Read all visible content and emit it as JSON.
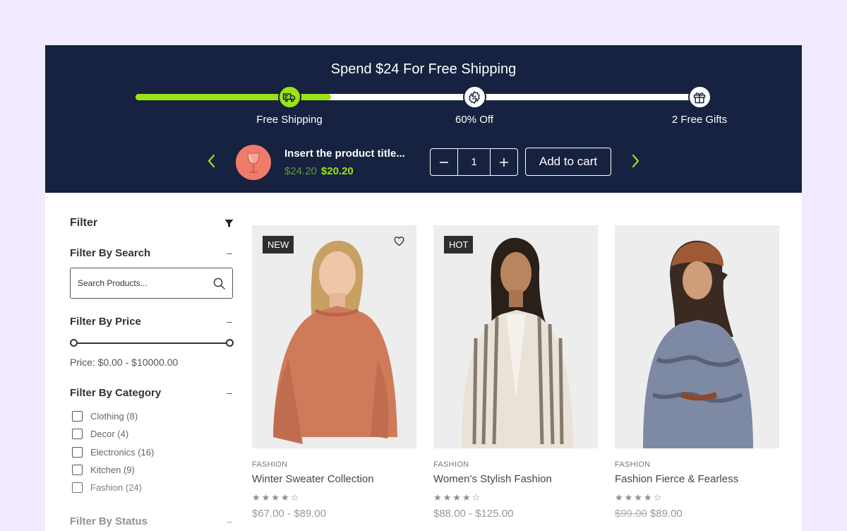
{
  "banner": {
    "title": "Spend $24 For Free Shipping",
    "progress_percent": 34,
    "milestones": [
      {
        "label": "Free Shipping",
        "icon": "truck-icon",
        "reached": true
      },
      {
        "label": "60% Off",
        "icon": "discount-badge-icon",
        "reached": false
      },
      {
        "label": "2 Free Gifts",
        "icon": "gift-icon",
        "reached": false
      }
    ],
    "product": {
      "title": "Insert the product title...",
      "old_price": "$24.20",
      "new_price": "$20.20",
      "quantity": "1",
      "add_to_cart": "Add to cart",
      "thumbnail_icon": "wine-glass-icon"
    },
    "colors": {
      "background": "#16223f",
      "accent": "#9be215"
    }
  },
  "sidebar": {
    "title": "Filter",
    "search": {
      "heading": "Filter By Search",
      "placeholder": "Search Products..."
    },
    "price": {
      "heading": "Filter By Price",
      "text": "Price: $0.00 - $10000.00"
    },
    "category": {
      "heading": "Filter By Category",
      "items": [
        {
          "label": "Clothing (8)"
        },
        {
          "label": "Decor (4)"
        },
        {
          "label": "Electronics (16)"
        },
        {
          "label": "Kitchen (9)"
        },
        {
          "label": "Fashion (24)"
        }
      ]
    },
    "status": {
      "heading": "Filter By Status"
    }
  },
  "products": [
    {
      "badge": "NEW",
      "category": "FASHION",
      "name": "Winter Sweater Collection",
      "rating": 4,
      "price": "$67.00 - $89.00",
      "old_price": "",
      "wishlist": true
    },
    {
      "badge": "HOT",
      "category": "FASHION",
      "name": "Women’s Stylish Fashion",
      "rating": 4,
      "price": "$88.00 - $125.00",
      "old_price": "",
      "wishlist": false
    },
    {
      "badge": "",
      "category": "FASHION",
      "name": "Fashion Fierce & Fearless",
      "rating": 4,
      "price": "$89.00",
      "old_price": "$99.00",
      "wishlist": false
    }
  ]
}
